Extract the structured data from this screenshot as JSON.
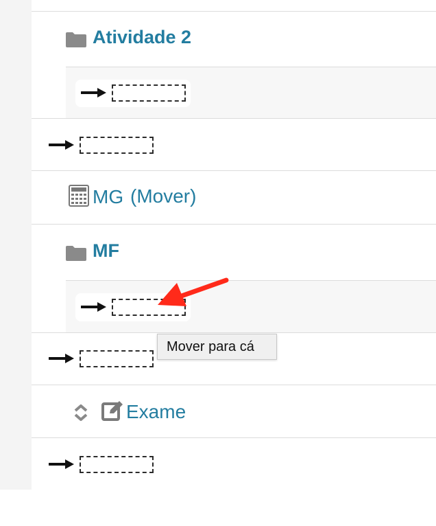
{
  "course": {
    "items": [
      {
        "title": "Atividade 2"
      },
      {
        "title": "MG",
        "suffix": "(Mover)"
      },
      {
        "title": "MF"
      },
      {
        "title": "Exame"
      }
    ]
  },
  "tooltip": {
    "text": "Mover para cá"
  },
  "colors": {
    "link": "#237da0",
    "annotation_arrow": "#ff2a1a"
  },
  "icons": [
    "folder-icon",
    "right-arrow-icon",
    "calculator-icon",
    "move-icon",
    "edit-icon"
  ]
}
